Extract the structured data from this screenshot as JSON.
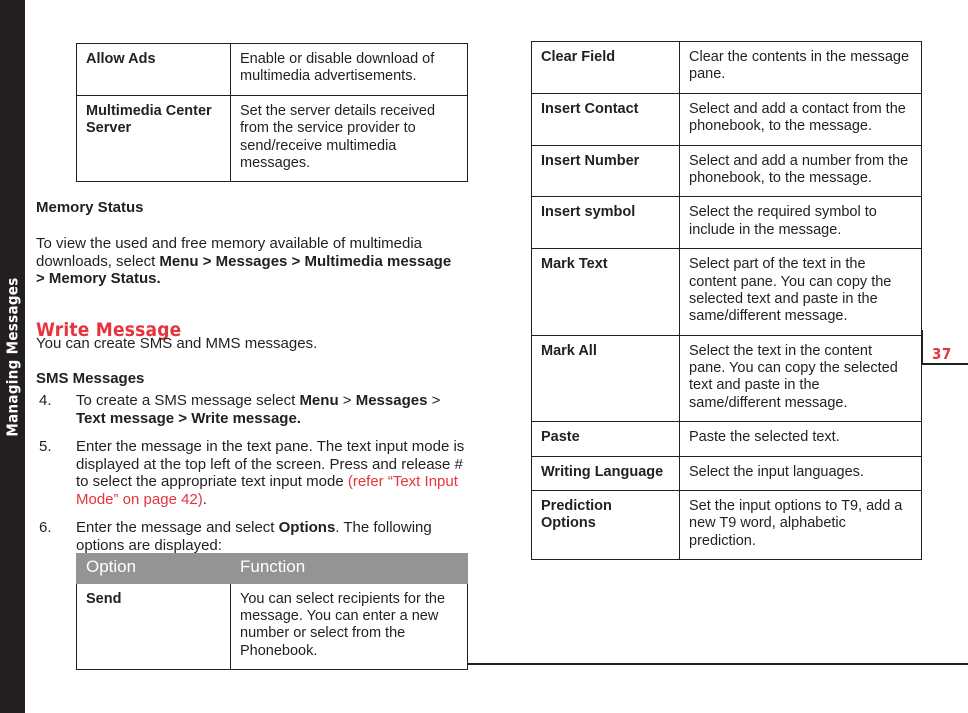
{
  "spine": {
    "label": "Managing Messages"
  },
  "page": {
    "number": "37"
  },
  "left_column": {
    "mms_table": {
      "rows": [
        {
          "option": "Allow Ads",
          "function": "Enable or disable download of multimedia advertisements."
        },
        {
          "option": "Multimedia Center Server",
          "function": "Set the server details received from the service provider to send/receive multimedia messages."
        }
      ]
    },
    "headings": {
      "memory_status": "Memory Status",
      "write_message": "Write Message",
      "sms_messages": "SMS Messages"
    },
    "paragraphs": {
      "memory_status_intro_a": "To view the used and free memory available of multimedia downloads, select ",
      "memory_status_path": "Menu > Messages > Multimedia message > Memory Status.",
      "create_sms_mms": "You can create SMS and MMS messages."
    },
    "steps": [
      {
        "number": "4.",
        "text_a": "To create a SMS message select ",
        "bold_a": "Menu",
        "sep_a": " > ",
        "bold_b": "Messages",
        "sep_b": " > ",
        "bold_c": "Text message > Write message."
      },
      {
        "number": "5.",
        "text_a": "Enter the message in the text pane. The text input mode is displayed at the top left of the screen. Press and release # to select the appropriate text input mode ",
        "red_ref": "(refer “Text Input Mode” on page 42)",
        "text_b": "."
      },
      {
        "number": "6.",
        "text_a": "Enter the message and select ",
        "bold_a": "Options",
        "text_b": ". The following options are displayed:"
      }
    ],
    "options_table": {
      "headers": {
        "option": "Option",
        "function": "Function"
      },
      "rows": [
        {
          "option": "Send",
          "function": "You can select recipients for the message. You can enter a new number or select from the Phonebook."
        }
      ]
    }
  },
  "right_column": {
    "options_table": {
      "rows": [
        {
          "option": "Clear Field",
          "function": "Clear the contents in the message pane."
        },
        {
          "option": "Insert Contact",
          "function": "Select and add a contact from the phonebook, to the message."
        },
        {
          "option": "Insert Number",
          "function": "Select and add a number from the phonebook, to the message."
        },
        {
          "option": "Insert symbol",
          "function": "Select the required symbol to include in the message."
        },
        {
          "option": "Mark Text",
          "function": "Select part of the text in the content pane. You can copy the selected text and paste in the same/different message."
        },
        {
          "option": "Mark All",
          "function": "Select the text in the content pane. You can copy the selected text and paste in the same/different message."
        },
        {
          "option": "Paste",
          "function": "Paste the selected text."
        },
        {
          "option": "Writing Language",
          "function": "Select the input languages."
        },
        {
          "option": "Prediction Options",
          "function": "Set the input options to T9, add a new T9 word, alphabetic prediction."
        }
      ]
    }
  },
  "colors": {
    "accent_red": "#e8323c",
    "ink": "#231f20",
    "header_gray": "#949494"
  }
}
